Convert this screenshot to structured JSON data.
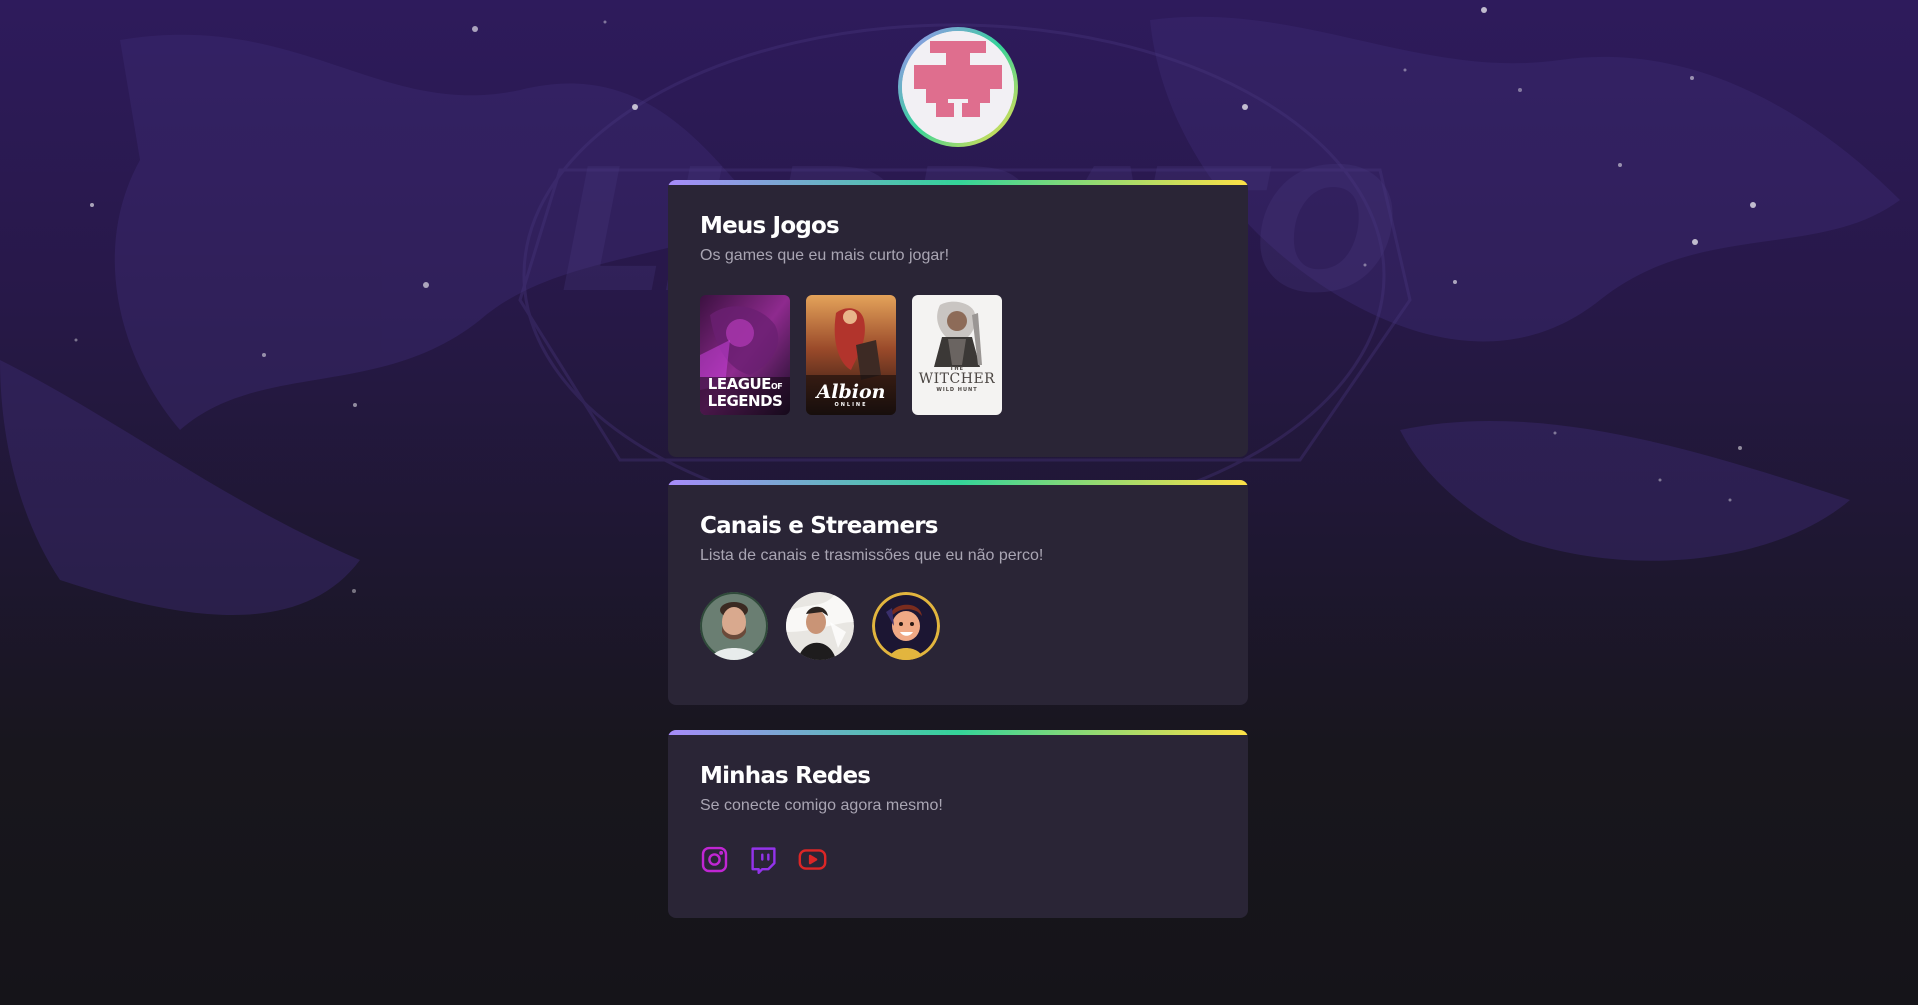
{
  "profile": {
    "avatar_icon": "pixel-invader-avatar",
    "avatar_colors": {
      "pixel": "#df6e8e",
      "bg": "#f2f0f4"
    }
  },
  "games_card": {
    "title": "Meus Jogos",
    "subtitle": "Os games que eu mais curto jogar!",
    "games": [
      {
        "name": "League of Legends",
        "label_line1": "LEAGUE",
        "label_of": "OF",
        "label_line2": "LEGENDS"
      },
      {
        "name": "Albion Online",
        "label": "Albion",
        "sublabel": "ONLINE"
      },
      {
        "name": "The Witcher 3: Wild Hunt",
        "label": "WITCHER",
        "label_top": "THE",
        "sublabel": "WILD HUNT"
      }
    ]
  },
  "streamers_card": {
    "title": "Canais e Streamers",
    "subtitle": "Lista de canais e trasmissões que eu não perco!",
    "streamers": [
      {
        "avatar": "streamer-avatar-1"
      },
      {
        "avatar": "streamer-avatar-2"
      },
      {
        "avatar": "streamer-avatar-3"
      }
    ]
  },
  "socials_card": {
    "title": "Minhas Redes",
    "subtitle": "Se conecte comigo agora mesmo!",
    "links": [
      {
        "network": "instagram",
        "icon": "instagram-icon",
        "color": "#c026d3"
      },
      {
        "network": "twitch",
        "icon": "twitch-icon",
        "color": "#9333ea"
      },
      {
        "network": "youtube",
        "icon": "youtube-icon",
        "color": "#dc2626"
      }
    ]
  },
  "theme": {
    "gradient": [
      "#a78bfa",
      "#34d399",
      "#fde047"
    ],
    "card_bg": "#2a2536",
    "subtitle_color": "#a9a5b3"
  }
}
